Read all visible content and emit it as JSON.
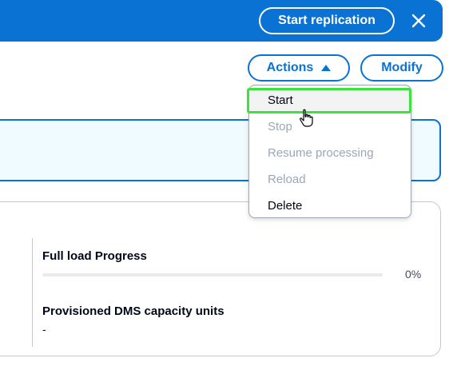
{
  "banner": {
    "start_replication_label": "Start replication",
    "close_icon": "close-icon",
    "color": "#0972d3"
  },
  "toolbar": {
    "actions_label": "Actions",
    "modify_label": "Modify",
    "actions_icon": "caret-up-icon"
  },
  "actions_menu": {
    "items": [
      {
        "label": "Start",
        "enabled": true,
        "hovered": true
      },
      {
        "label": "Stop",
        "enabled": false
      },
      {
        "label": "Resume processing",
        "enabled": false
      },
      {
        "label": "Reload",
        "enabled": false
      },
      {
        "label": "Delete",
        "enabled": true
      }
    ],
    "highlight_color": "#3ee23e"
  },
  "details": {
    "full_load_label": "Full load Progress",
    "full_load_value": 0,
    "full_load_pct_text": "0%",
    "capacity_label": "Provisioned DMS capacity units",
    "capacity_value": "-"
  }
}
